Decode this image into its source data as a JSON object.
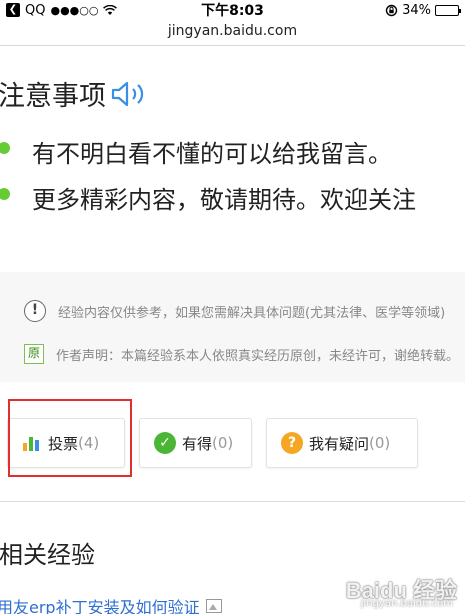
{
  "status_bar": {
    "carrier": "QQ",
    "signal": "●●●○○",
    "time": "下午8:03",
    "battery": "34%",
    "battery_level": 0.34
  },
  "browser": {
    "url": "jingyan.baidu.com"
  },
  "notes": {
    "title": "注意事项",
    "items": [
      "有不明白看不懂的可以给我留言。",
      "更多精彩内容，敬请期待。欢迎关注"
    ]
  },
  "disclaimer": {
    "text": "经验内容仅供参考，如果您需解决具体问题(尤其法律、医学等领域)",
    "original_badge": "原",
    "author_statement": "作者声明：本篇经验系本人依照真实经历原创，未经许可，谢绝转载。"
  },
  "actions": {
    "vote_label": "投票",
    "vote_count": "(4)",
    "useful_label": "有得",
    "useful_count": "(0)",
    "question_label": "我有疑问",
    "question_count": "(0)"
  },
  "related": {
    "title": "相关经验",
    "items": [
      "用友erp补丁安装及如何验证"
    ]
  },
  "watermark": {
    "brand": "Baidu 经验",
    "sub": "jingyan.baidu.com"
  },
  "colors": {
    "bullet": "#66cc33",
    "link": "#2d6fd2",
    "highlight": "#e0302e",
    "useful": "#4bb536",
    "question": "#f5a623"
  }
}
